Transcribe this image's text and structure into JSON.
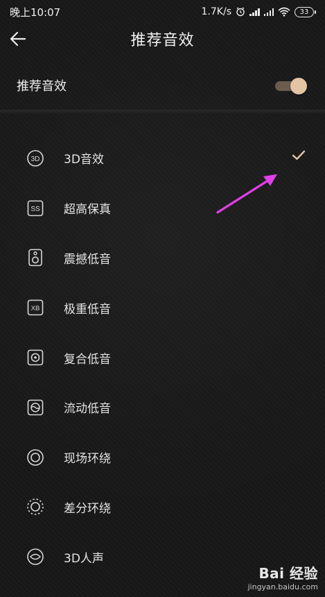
{
  "status_bar": {
    "time": "晚上10:07",
    "network_speed": "1.7K/s",
    "battery": "33"
  },
  "header": {
    "title": "推荐音效"
  },
  "toggle": {
    "label": "推荐音效",
    "state": "on"
  },
  "effects": [
    {
      "label": "3D音效",
      "icon": "3d-icon",
      "selected": true
    },
    {
      "label": "超高保真",
      "icon": "ss-icon"
    },
    {
      "label": "震撼低音",
      "icon": "speaker-icon"
    },
    {
      "label": "极重低音",
      "icon": "xb-icon"
    },
    {
      "label": "复合低音",
      "icon": "target-icon"
    },
    {
      "label": "流动低音",
      "icon": "flow-icon"
    },
    {
      "label": "现场环绕",
      "icon": "surround-icon"
    },
    {
      "label": "差分环绕",
      "icon": "dotted-ring-icon"
    },
    {
      "label": "3D人声",
      "icon": "eye-icon"
    }
  ],
  "colors": {
    "accent": "#e3c5a4",
    "arrow": "#e040e6"
  },
  "watermark": {
    "brand": "Bai 经验",
    "url": "jingyan.baidu.com"
  }
}
